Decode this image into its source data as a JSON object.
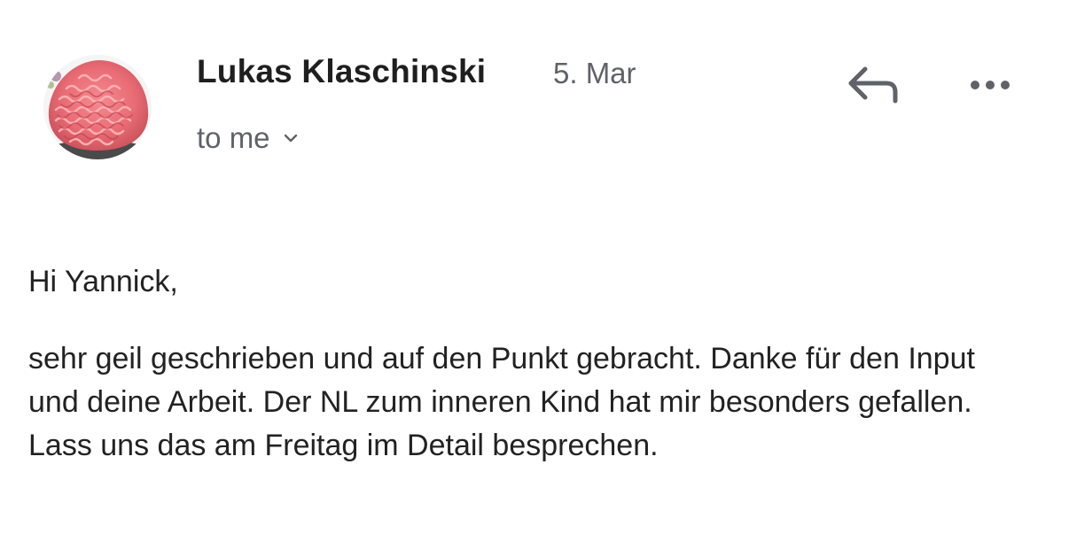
{
  "email": {
    "sender_name": "Lukas Klaschinski",
    "date": "5. Mar",
    "recipient": "to me",
    "greeting": "Hi Yannick,",
    "body": "sehr geil geschrieben und auf den Punkt gebracht. Danke für den Input und deine Arbeit. Der NL zum inneren Kind hat mir besonders gefallen. Lass uns das am Freitag im Detail besprechen."
  },
  "actions": {
    "reply_icon": "reply-arrow-icon",
    "more_icon": "more-horizontal-icon"
  },
  "icons": {
    "avatar": "profile-photo",
    "recipient_expand": "chevron-down-icon"
  },
  "colors": {
    "sender": "#1f1f1f",
    "meta": "#5f6368",
    "body": "#222222",
    "icon": "#5f6368",
    "background": "#ffffff"
  }
}
